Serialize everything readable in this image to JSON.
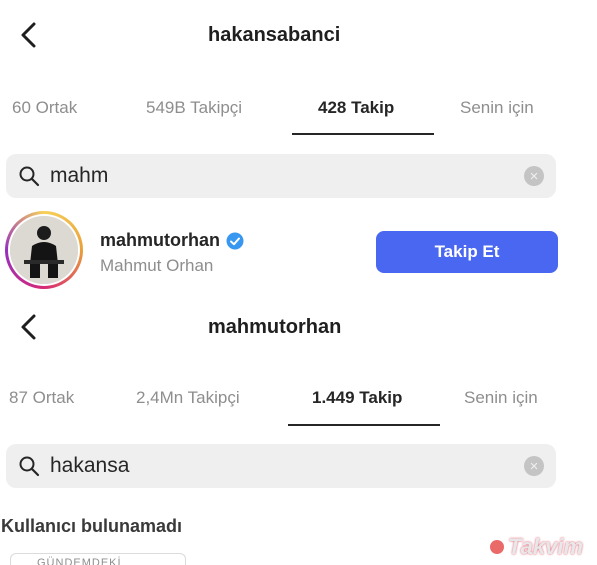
{
  "screen1": {
    "title": "hakansabanci",
    "tabs": [
      {
        "label": "60 Ortak"
      },
      {
        "label": "549B Takipçi"
      },
      {
        "label": "428 Takip"
      },
      {
        "label": "Senin için"
      }
    ],
    "search": {
      "value": "mahm"
    },
    "result": {
      "username": "mahmutorhan",
      "fullname": "Mahmut Orhan",
      "follow_label": "Takip Et"
    }
  },
  "screen2": {
    "title": "mahmutorhan",
    "tabs": [
      {
        "label": "87 Ortak"
      },
      {
        "label": "2,4Mn Takipçi"
      },
      {
        "label": "1.449 Takip"
      },
      {
        "label": "Senin için"
      }
    ],
    "search": {
      "value": "hakansa"
    },
    "empty_message": "Kullanıcı bulunamadı",
    "cutoff_button": "GÜNDEMDEKİ SEÇİMLER"
  },
  "watermark": "Takvim",
  "colors": {
    "accent": "#4a67f2",
    "verified": "#3897f0"
  },
  "icons": [
    "back-arrow-icon",
    "search-icon",
    "clear-icon",
    "verified-badge-icon"
  ]
}
